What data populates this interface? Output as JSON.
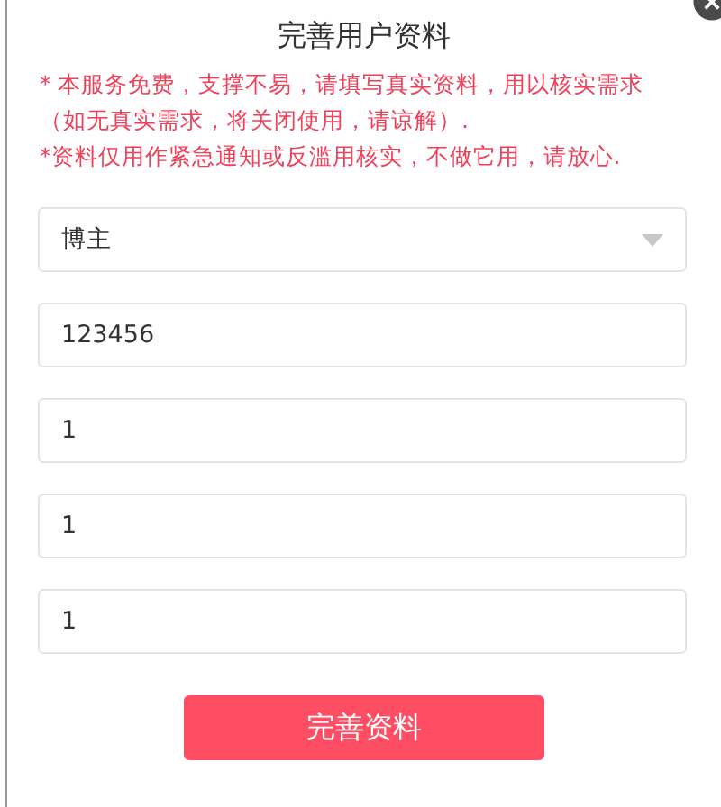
{
  "title": "完善用户资料",
  "notes": [
    "* 本服务免费，支撑不易，请填写真实资料，用以核实需求（如无真实需求，将关闭使用，请谅解）.",
    "*资料仅用作紧急通知或反滥用核实，不做它用，请放心."
  ],
  "fields": [
    {
      "kind": "select",
      "value": "博主"
    },
    {
      "kind": "input",
      "value": "123456"
    },
    {
      "kind": "input",
      "value": "1"
    },
    {
      "kind": "input",
      "value": "1"
    },
    {
      "kind": "input",
      "value": "1"
    }
  ],
  "submit": "完善资料"
}
